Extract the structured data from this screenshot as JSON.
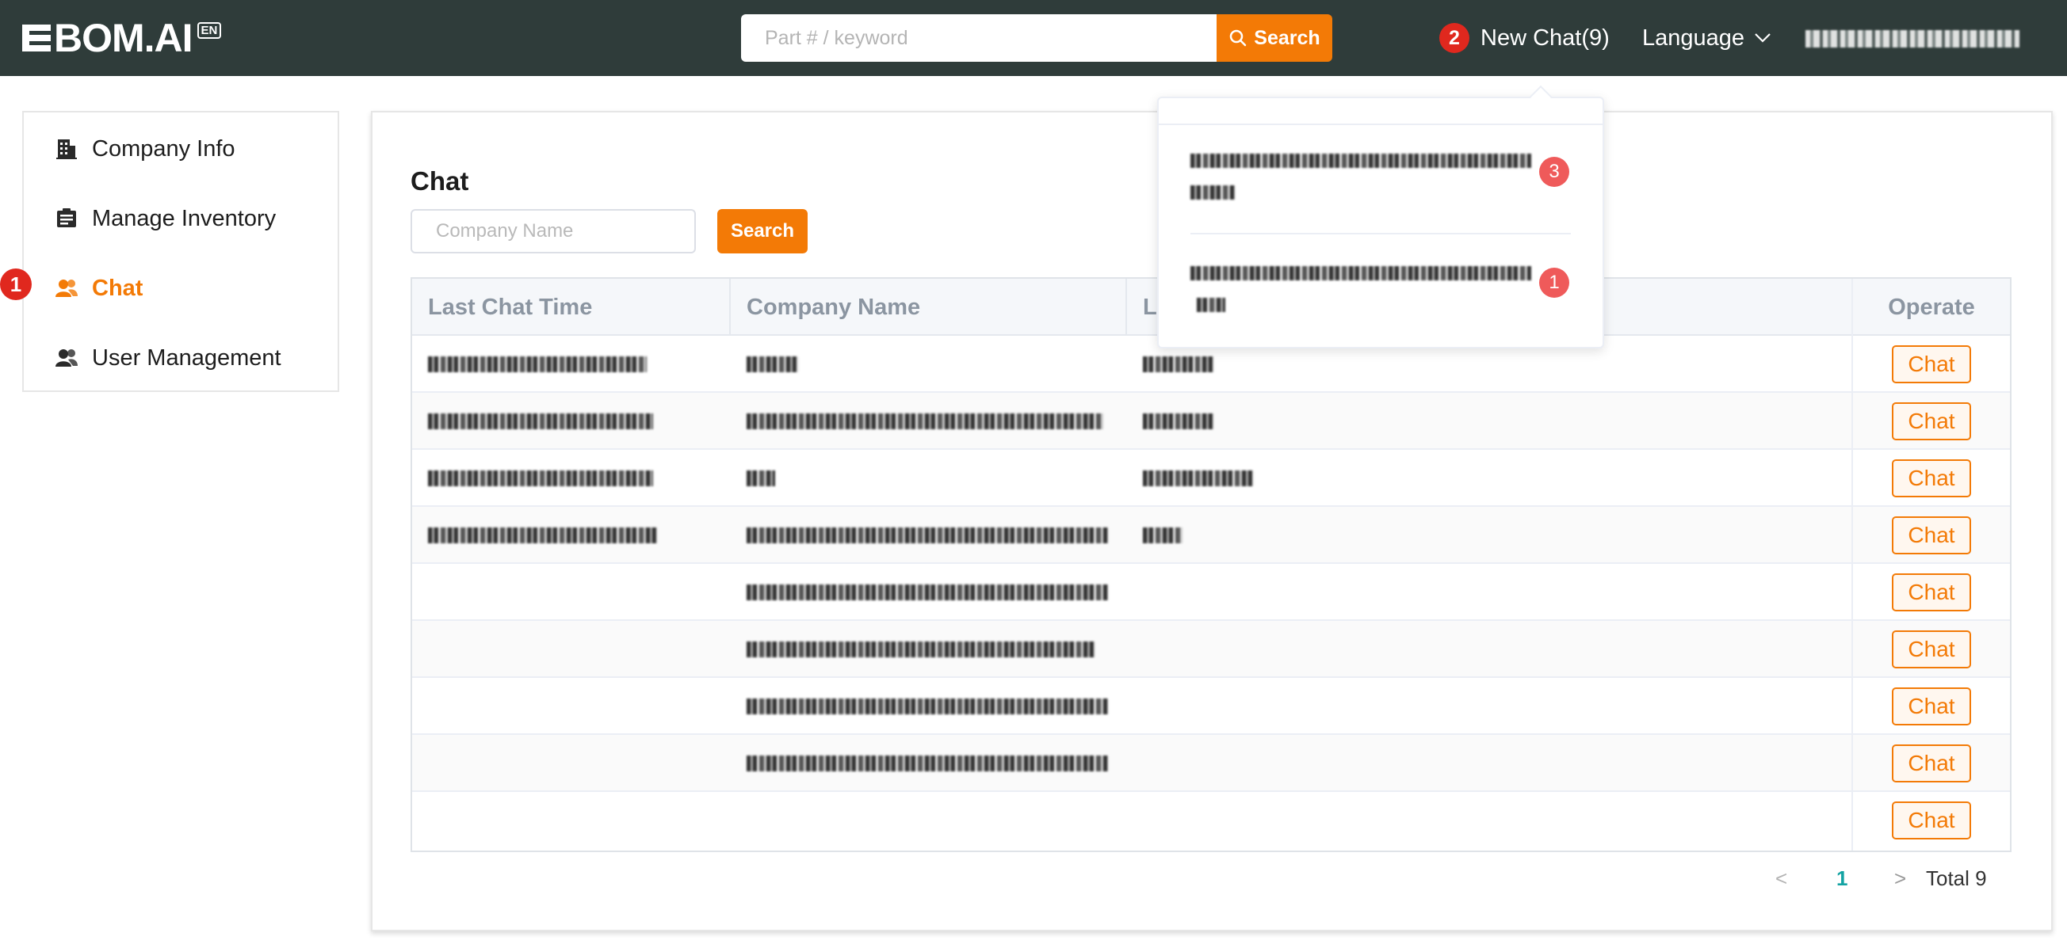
{
  "header": {
    "logo_text": "BOM.AI",
    "logo_badge": "EN",
    "search_placeholder": "Part # / keyword",
    "search_button": "Search",
    "new_chat_badge": "2",
    "new_chat_label": "New Chat(9)",
    "language_label": "Language"
  },
  "sidebar": {
    "badge": "1",
    "items": [
      {
        "label": "Company Info",
        "icon": "building-icon"
      },
      {
        "label": "Manage Inventory",
        "icon": "inventory-icon"
      },
      {
        "label": "Chat",
        "icon": "users-icon"
      },
      {
        "label": "User Management",
        "icon": "user-icon"
      }
    ]
  },
  "main": {
    "title": "Chat",
    "company_placeholder": "Company Name",
    "search_button": "Search",
    "columns": [
      "Last Chat Time",
      "Company Name",
      "L",
      "Operate"
    ],
    "row_button": "Chat",
    "pagination": {
      "prev": "<",
      "page": "1",
      "next": ">",
      "total": "Total 9"
    }
  },
  "dropdown": {
    "items": [
      {
        "count": "3"
      },
      {
        "count": "1"
      }
    ]
  },
  "colors": {
    "header_bg": "#2f3c3a",
    "accent": "#f37a06",
    "badge_red": "#e0281e",
    "page_active": "#14a3a3"
  }
}
